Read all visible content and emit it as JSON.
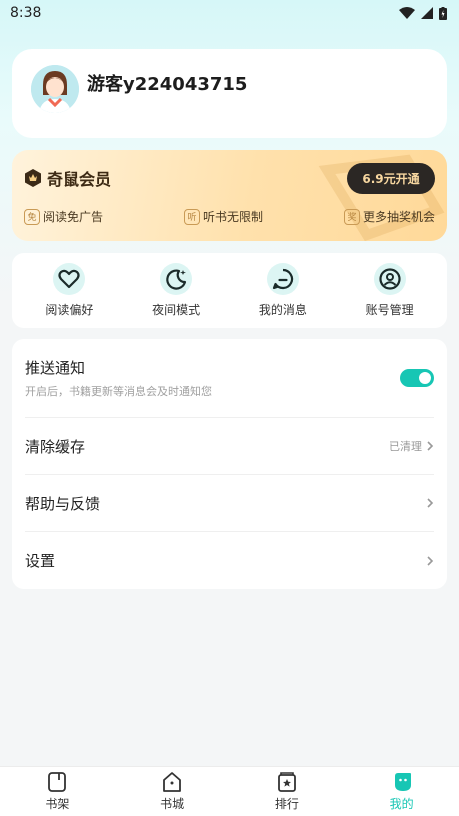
{
  "status_bar": {
    "time": "8:38"
  },
  "profile": {
    "username": "游客y224043715"
  },
  "vip": {
    "title": "奇鼠会员",
    "button_label": "6.9元开通",
    "perks": [
      {
        "badge": "免",
        "label": "阅读免广告"
      },
      {
        "badge": "听",
        "label": "听书无限制"
      },
      {
        "badge": "奖",
        "label": "更多抽奖机会"
      }
    ]
  },
  "quick_actions": [
    {
      "label": "阅读偏好",
      "icon": "heart-icon"
    },
    {
      "label": "夜间模式",
      "icon": "moon-icon"
    },
    {
      "label": "我的消息",
      "icon": "message-icon"
    },
    {
      "label": "账号管理",
      "icon": "account-icon"
    }
  ],
  "settings": {
    "push": {
      "title": "推送通知",
      "subtitle": "开启后，书籍更新等消息会及时通知您",
      "enabled": true
    },
    "cache": {
      "title": "清除缓存",
      "status": "已清理"
    },
    "help": {
      "title": "帮助与反馈"
    },
    "prefs": {
      "title": "设置"
    }
  },
  "tabbar": {
    "items": [
      {
        "label": "书架",
        "icon": "bookshelf-icon"
      },
      {
        "label": "书城",
        "icon": "bookstore-icon"
      },
      {
        "label": "排行",
        "icon": "ranking-icon"
      },
      {
        "label": "我的",
        "icon": "mine-icon",
        "active": true
      }
    ]
  },
  "colors": {
    "accent": "#17c6b4",
    "vip_dark": "#2b2724"
  }
}
